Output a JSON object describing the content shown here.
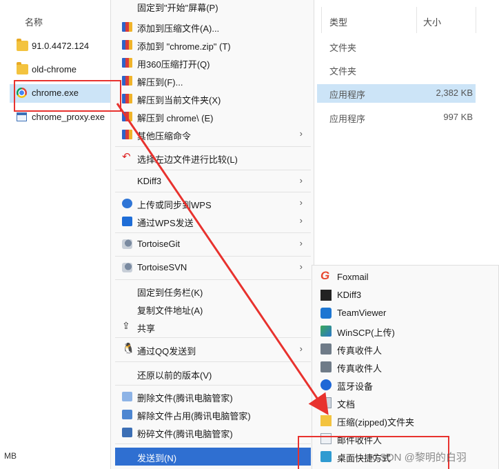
{
  "explorer": {
    "columns": {
      "name": "名称",
      "type": "类型",
      "size": "大小"
    },
    "files": [
      {
        "name": "91.0.4472.124",
        "type": "文件夹",
        "size": ""
      },
      {
        "name": "old-chrome",
        "type": "文件夹",
        "size": ""
      },
      {
        "name": "chrome.exe",
        "type": "应用程序",
        "size": "2,382 KB"
      },
      {
        "name": "chrome_proxy.exe",
        "type": "应用程序",
        "size": "997 KB"
      }
    ],
    "status": "MB"
  },
  "context_menu": {
    "items": [
      {
        "label": "固定到\"开始\"屏幕(P)"
      },
      {
        "label": "添加到压缩文件(A)...",
        "icon": "winrar-icon"
      },
      {
        "label": "添加到 \"chrome.zip\" (T)",
        "icon": "winrar-icon"
      },
      {
        "label": "用360压缩打开(Q)",
        "icon": "winrar-icon"
      },
      {
        "label": "解压到(F)...",
        "icon": "winrar-icon"
      },
      {
        "label": "解压到当前文件夹(X)",
        "icon": "winrar-icon"
      },
      {
        "label": "解压到 chrome\\ (E)",
        "icon": "winrar-icon"
      },
      {
        "label": "其他压缩命令",
        "icon": "winrar-icon",
        "submenu": true
      },
      {
        "label": "选择左边文件进行比较(L)",
        "icon": "undo-icon"
      },
      {
        "label": "KDiff3",
        "submenu": true
      },
      {
        "label": "上传或同步到WPS",
        "icon": "cloud-upload-icon",
        "submenu": true
      },
      {
        "label": "通过WPS发送",
        "icon": "wps-send-icon",
        "submenu": true
      },
      {
        "label": "TortoiseGit",
        "icon": "tortoise-icon",
        "submenu": true
      },
      {
        "label": "TortoiseSVN",
        "icon": "tortoise-icon",
        "submenu": true
      },
      {
        "label": "固定到任务栏(K)"
      },
      {
        "label": "复制文件地址(A)"
      },
      {
        "label": "共享",
        "icon": "share-icon"
      },
      {
        "label": "通过QQ发送到",
        "icon": "qq-icon",
        "submenu": true
      },
      {
        "label": "还原以前的版本(V)"
      },
      {
        "label": "删除文件(腾讯电脑管家)",
        "icon": "guard-delete-icon"
      },
      {
        "label": "解除文件占用(腾讯电脑管家)",
        "icon": "guard-unlock-icon"
      },
      {
        "label": "粉碎文件(腾讯电脑管家)",
        "icon": "guard-shred-icon"
      },
      {
        "label": "发送到(N)",
        "submenu": true,
        "highlighted": true
      }
    ]
  },
  "sendto_menu": {
    "items": [
      {
        "label": "Foxmail",
        "icon": "foxmail-icon"
      },
      {
        "label": "KDiff3",
        "icon": "kdiff3-icon"
      },
      {
        "label": "TeamViewer",
        "icon": "teamviewer-icon"
      },
      {
        "label": "WinSCP(上传)",
        "icon": "winscp-icon"
      },
      {
        "label": "传真收件人",
        "icon": "fax-icon"
      },
      {
        "label": "传真收件人",
        "icon": "fax-icon"
      },
      {
        "label": "蓝牙设备",
        "icon": "bluetooth-icon"
      },
      {
        "label": "文档",
        "icon": "document-icon"
      },
      {
        "label": "压缩(zipped)文件夹",
        "icon": "zip-folder-icon"
      },
      {
        "label": "邮件收件人",
        "icon": "mail-icon"
      },
      {
        "label": "桌面快捷方式",
        "icon": "desktop-icon"
      }
    ]
  },
  "watermark": "CSDN @黎明的白羽",
  "annotation_color": "#e8322e"
}
